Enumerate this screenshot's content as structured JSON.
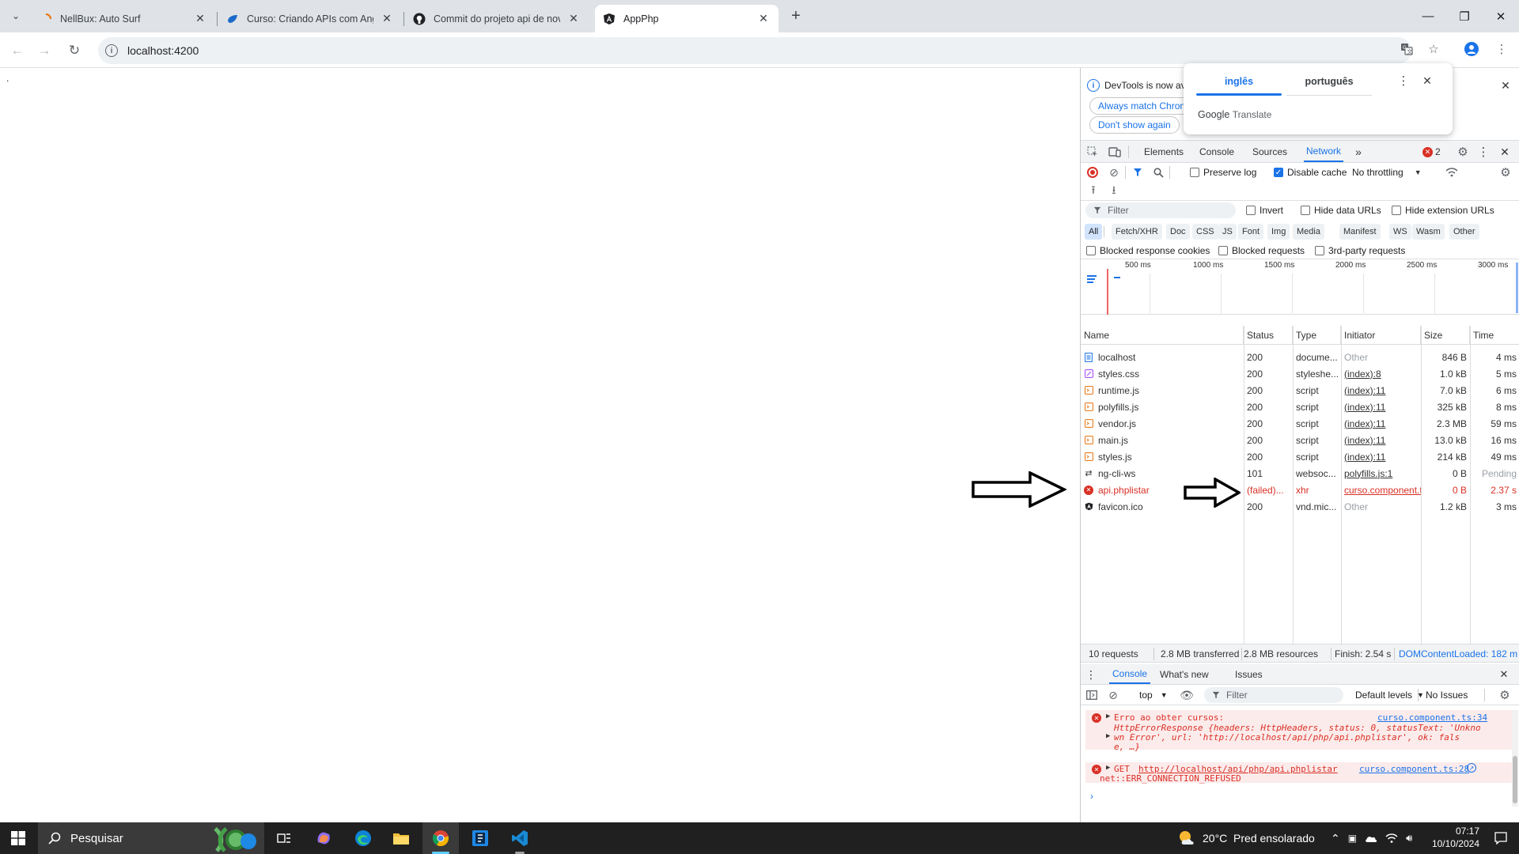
{
  "browser": {
    "tabs": [
      {
        "title": "NellBux: Auto Surf",
        "icon": "spinner-icon"
      },
      {
        "title": "Curso: Criando APIs com Angul",
        "icon": "udemy-icon"
      },
      {
        "title": "Commit do projeto api de novo",
        "icon": "github-icon"
      },
      {
        "title": "AppPhp",
        "icon": "angular-icon",
        "active": true
      }
    ],
    "url": "localhost:4200"
  },
  "page": {
    "content": "."
  },
  "translate_popup": {
    "lang_source": "inglês",
    "lang_target": "português",
    "brand": "Google",
    "brand_suffix": "Translate"
  },
  "devtools": {
    "infobar": {
      "text": "DevTools is now av",
      "btn_match": "Always match Chron",
      "btn_dont_show": "Don't show again"
    },
    "tabs": [
      "Elements",
      "Console",
      "Sources",
      "Network"
    ],
    "active_tab": "Network",
    "error_count": "2",
    "toolbar": {
      "preserve_log": "Preserve log",
      "disable_cache": "Disable cache",
      "throttling": "No throttling"
    },
    "filter": {
      "placeholder": "Filter",
      "invert": "Invert",
      "hide_data_urls": "Hide data URLs",
      "hide_extension_urls": "Hide extension URLs"
    },
    "type_filters": [
      "All",
      "Fetch/XHR",
      "Doc",
      "CSS",
      "JS",
      "Font",
      "Img",
      "Media",
      "Manifest",
      "WS",
      "Wasm",
      "Other"
    ],
    "options": {
      "blocked_cookies": "Blocked response cookies",
      "blocked_requests": "Blocked requests",
      "third_party": "3rd-party requests"
    },
    "timeline_ticks": [
      "500 ms",
      "1000 ms",
      "1500 ms",
      "2000 ms",
      "2500 ms",
      "3000 ms"
    ],
    "columns": [
      "Name",
      "Status",
      "Type",
      "Initiator",
      "Size",
      "Time"
    ],
    "requests": [
      {
        "name": "localhost",
        "status": "200",
        "type": "docume...",
        "initiator": "Other",
        "size": "846 B",
        "time": "4 ms",
        "icon": "document-icon"
      },
      {
        "name": "styles.css",
        "status": "200",
        "type": "styleshe...",
        "initiator": "(index):8",
        "size": "1.0 kB",
        "time": "5 ms",
        "icon": "stylesheet-icon"
      },
      {
        "name": "runtime.js",
        "status": "200",
        "type": "script",
        "initiator": "(index):11",
        "size": "7.0 kB",
        "time": "6 ms",
        "icon": "script-icon"
      },
      {
        "name": "polyfills.js",
        "status": "200",
        "type": "script",
        "initiator": "(index):11",
        "size": "325 kB",
        "time": "8 ms",
        "icon": "script-icon"
      },
      {
        "name": "vendor.js",
        "status": "200",
        "type": "script",
        "initiator": "(index):11",
        "size": "2.3 MB",
        "time": "59 ms",
        "icon": "script-icon"
      },
      {
        "name": "main.js",
        "status": "200",
        "type": "script",
        "initiator": "(index):11",
        "size": "13.0 kB",
        "time": "16 ms",
        "icon": "script-icon"
      },
      {
        "name": "styles.js",
        "status": "200",
        "type": "script",
        "initiator": "(index):11",
        "size": "214 kB",
        "time": "49 ms",
        "icon": "script-icon"
      },
      {
        "name": "ng-cli-ws",
        "status": "101",
        "type": "websoc...",
        "initiator": "polyfills.js:1",
        "size": "0 B",
        "time": "Pending",
        "icon": "websocket-icon"
      },
      {
        "name": "api.phplistar",
        "status": "(failed)...",
        "type": "xhr",
        "initiator": "curso.component.t",
        "size": "0 B",
        "time": "2.37 s",
        "icon": "error-icon",
        "failed": true
      },
      {
        "name": "favicon.ico",
        "status": "200",
        "type": "vnd.mic...",
        "initiator": "Other",
        "size": "1.2 kB",
        "time": "3 ms",
        "icon": "angular-icon"
      }
    ],
    "summary": {
      "requests": "10 requests",
      "transferred": "2.8 MB transferred",
      "resources": "2.8 MB resources",
      "finish": "Finish: 2.54 s",
      "dcl": "DOMContentLoaded: 182 m"
    },
    "drawer": {
      "tabs": [
        "Console",
        "What's new",
        "Issues"
      ],
      "context": "top",
      "filter_placeholder": "Filter",
      "levels": "Default levels",
      "issues": "No Issues",
      "messages": [
        {
          "title": "Erro ao obter cursos:",
          "source": "curso.component.ts:34",
          "line2": "HttpErrorResponse {headers: HttpHeaders, status: 0, statusText: 'Unkno",
          "line3": "wn Error', url: 'http://localhost/api/php/api.phplistar', ok: fals",
          "line4": "e, …}"
        },
        {
          "prefix": "GET",
          "url": "http://localhost/api/php/api.phplistar",
          "source": "curso.component.ts:28",
          "detail": "net::ERR_CONNECTION_REFUSED"
        }
      ]
    }
  },
  "taskbar": {
    "search_placeholder": "Pesquisar",
    "weather": "20°C  Pred ensolarado",
    "time": "07:17",
    "date": "10/10/2024"
  }
}
